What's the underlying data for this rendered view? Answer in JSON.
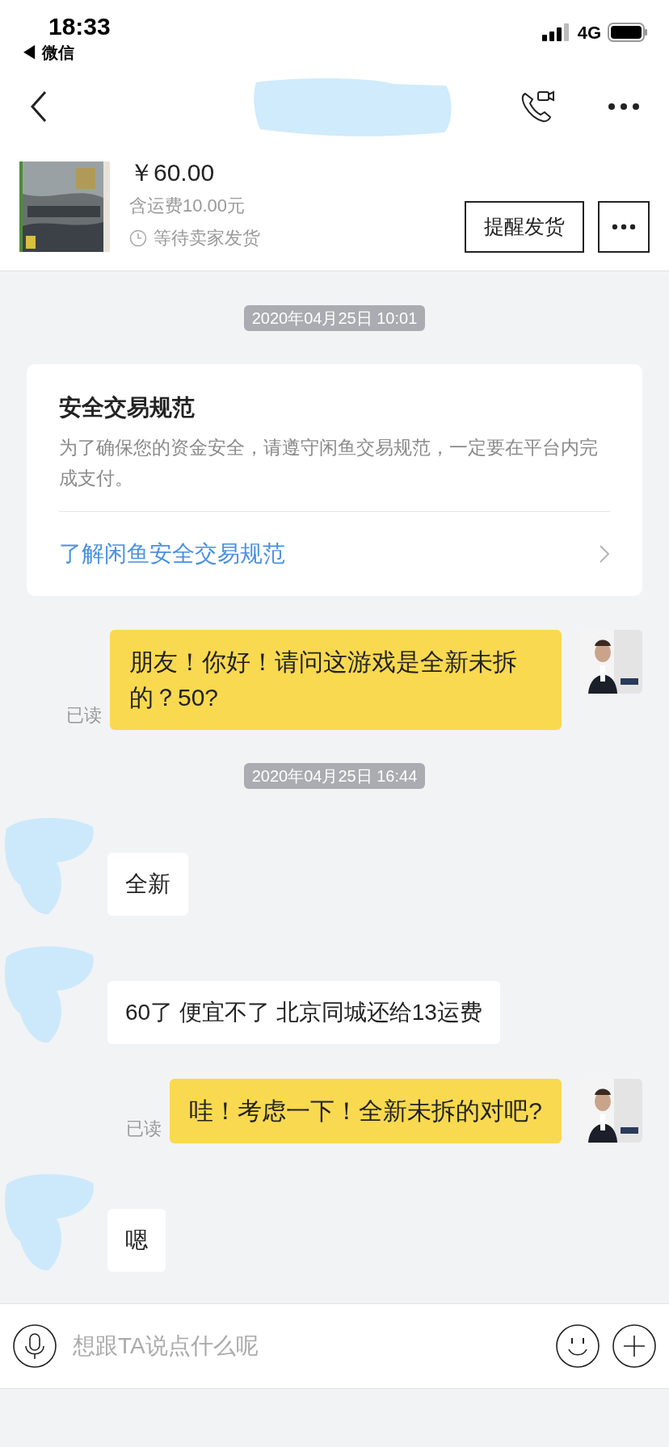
{
  "status_bar": {
    "time": "18:33",
    "back_app": "◀ 微信",
    "network": "4G"
  },
  "product": {
    "price": "￥60.00",
    "shipping": "含运费10.00元",
    "status": "等待卖家发货",
    "action": "提醒发货"
  },
  "messages": [
    {
      "kind": "timestamp",
      "text": "2020年04月25日 10:01"
    },
    {
      "kind": "notice",
      "title": "安全交易规范",
      "body": "为了确保您的资金安全，请遵守闲鱼交易规范，一定要在平台内完成支付。",
      "link": "了解闲鱼安全交易规范"
    },
    {
      "kind": "outgoing",
      "text": "朋友！你好！请问这游戏是全新未拆的？50?",
      "read_label": "已读"
    },
    {
      "kind": "timestamp",
      "text": "2020年04月25日 16:44"
    },
    {
      "kind": "incoming",
      "text": "全新"
    },
    {
      "kind": "incoming",
      "text": "60了  便宜不了  北京同城还给13运费"
    },
    {
      "kind": "outgoing",
      "text": "哇！考虑一下！全新未拆的对吧?",
      "read_label": "已读"
    },
    {
      "kind": "incoming",
      "text": "嗯"
    }
  ],
  "input": {
    "placeholder": "想跟TA说点什么呢"
  }
}
